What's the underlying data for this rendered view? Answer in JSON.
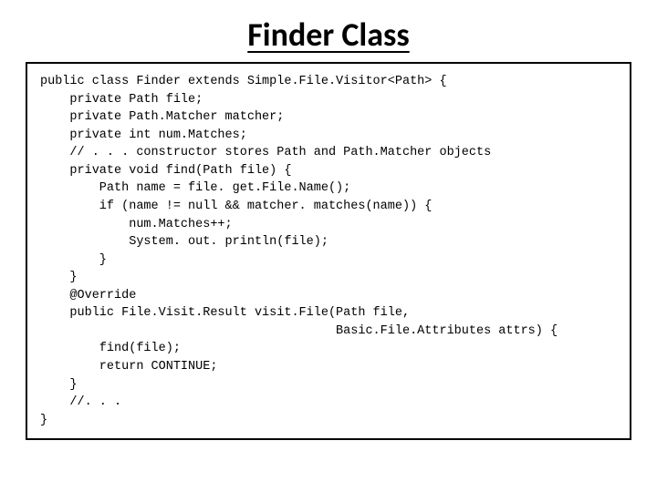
{
  "title": "Finder Class",
  "code": {
    "l01": "public class Finder extends Simple.File.Visitor<Path> {",
    "l02": "    private Path file;",
    "l03": "    private Path.Matcher matcher;",
    "l04": "    private int num.Matches;",
    "l05": "    // . . . constructor stores Path and Path.Matcher objects",
    "l06": "    private void find(Path file) {",
    "l07": "        Path name = file. get.File.Name();",
    "l08": "        if (name != null && matcher. matches(name)) {",
    "l09": "            num.Matches++;",
    "l10": "            System. out. println(file);",
    "l11": "        }",
    "l12": "    }",
    "l13": "    @Override",
    "l14": "    public File.Visit.Result visit.File(Path file,",
    "l15": "                                        Basic.File.Attributes attrs) {",
    "l16": "        find(file);",
    "l17": "        return CONTINUE;",
    "l18": "    }",
    "l19": "    //. . .",
    "l20": "}"
  }
}
